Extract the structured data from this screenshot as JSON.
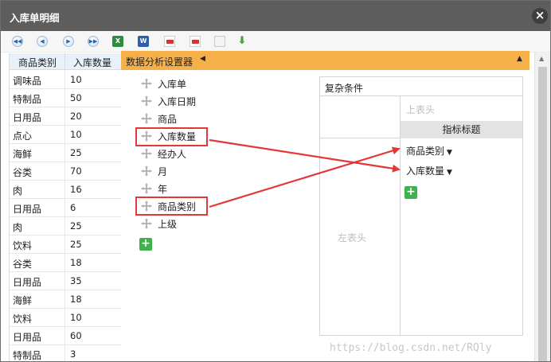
{
  "window": {
    "title": "入库单明细",
    "close_icon": "×"
  },
  "toolbar": {
    "icons": [
      "first-page-icon",
      "prev-page-icon",
      "next-page-icon",
      "last-page-icon",
      "excel-icon",
      "word-icon",
      "pdf-icon",
      "pdf-icon",
      "document-icon",
      "download-icon"
    ]
  },
  "grid": {
    "columns": [
      "商品类别",
      "入库数量"
    ],
    "rows": [
      [
        "调味品",
        "10"
      ],
      [
        "特制品",
        "50"
      ],
      [
        "日用品",
        "20"
      ],
      [
        "点心",
        "10"
      ],
      [
        "海鲜",
        "25"
      ],
      [
        "谷类",
        "70"
      ],
      [
        "肉",
        "16"
      ],
      [
        "日用品",
        "6"
      ],
      [
        "肉",
        "25"
      ],
      [
        "饮料",
        "25"
      ],
      [
        "谷类",
        "18"
      ],
      [
        "日用品",
        "35"
      ],
      [
        "海鲜",
        "18"
      ],
      [
        "饮料",
        "10"
      ],
      [
        "日用品",
        "60"
      ],
      [
        "特制品",
        "3"
      ]
    ]
  },
  "panel": {
    "title": "数据分析设置器",
    "caret": "◀",
    "collapse": "▲"
  },
  "fields": [
    "入库单",
    "入库日期",
    "商品",
    "入库数量",
    "经办人",
    "月",
    "年",
    "商品类别",
    "上级"
  ],
  "conditions": {
    "title": "复杂条件",
    "top_header": "上表头",
    "metric_title": "指标标题",
    "left_header": "左表头",
    "metrics": [
      "商品类别",
      "入库数量"
    ],
    "dropdown": "▼"
  },
  "add_label": "+",
  "scroll_up": "▲",
  "watermark": "https://blog.csdn.net/RQly",
  "colors": {
    "titlebar": "#5d5d5d",
    "panel_bar": "#f6b04a",
    "highlight": "#e23838",
    "add_button": "#3fb24f"
  }
}
